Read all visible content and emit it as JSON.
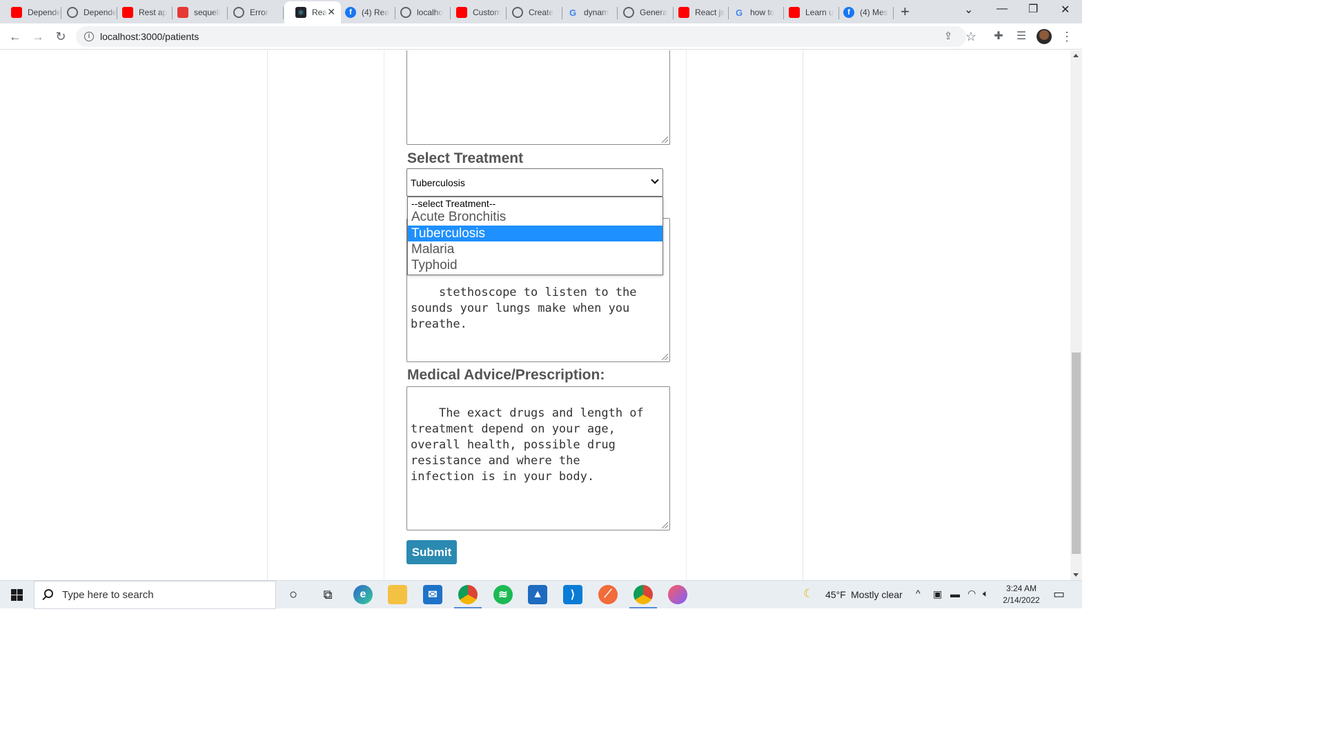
{
  "browser": {
    "tabs": [
      {
        "title": "Depende",
        "favicon": "youtube-icon"
      },
      {
        "title": "Depende",
        "favicon": "globe-icon"
      },
      {
        "title": "Rest ap",
        "favicon": "youtube-icon"
      },
      {
        "title": "sequeli",
        "favicon": "red-app-icon"
      },
      {
        "title": "Error",
        "favicon": "globe-icon"
      },
      {
        "title": "Rea",
        "favicon": "react-icon",
        "active": true
      },
      {
        "title": "(4) Rea",
        "favicon": "facebook-icon"
      },
      {
        "title": "localho",
        "favicon": "globe-icon"
      },
      {
        "title": "Custom",
        "favicon": "youtube-icon"
      },
      {
        "title": "Create",
        "favicon": "globe-icon"
      },
      {
        "title": "dynam",
        "favicon": "google-icon"
      },
      {
        "title": "Genera",
        "favicon": "globe-icon"
      },
      {
        "title": "React js",
        "favicon": "youtube-icon"
      },
      {
        "title": "how to",
        "favicon": "google-icon"
      },
      {
        "title": "Learn u",
        "favicon": "youtube-icon"
      },
      {
        "title": "(4) Mes",
        "favicon": "facebook-icon"
      }
    ],
    "url": "localhost:3000/patients"
  },
  "form": {
    "diagnosis_text": "stethoscope to listen to the\nsounds your lungs make when you\nbreathe.",
    "treatment_label": "Select Treatment",
    "treatment_selected": "Tuberculosis",
    "treatment_options": [
      "--select Treatment--",
      "Acute Bronchitis",
      "Tuberculosis",
      "Malaria",
      "Typhoid"
    ],
    "advice_label": "Medical Advice/Prescription:",
    "advice_text": "The exact drugs and length of\ntreatment depend on your age,\noverall health, possible drug\nresistance and where the\ninfection is in your body.",
    "submit_label": "Submit"
  },
  "taskbar": {
    "search_placeholder": "Type here to search",
    "weather_temp": "45°F",
    "weather_desc": "Mostly clear",
    "time": "3:24 AM",
    "date": "2/14/2022"
  },
  "colors": {
    "submit_bg": "#2b8ab1",
    "option_highlight": "#1e90ff"
  }
}
